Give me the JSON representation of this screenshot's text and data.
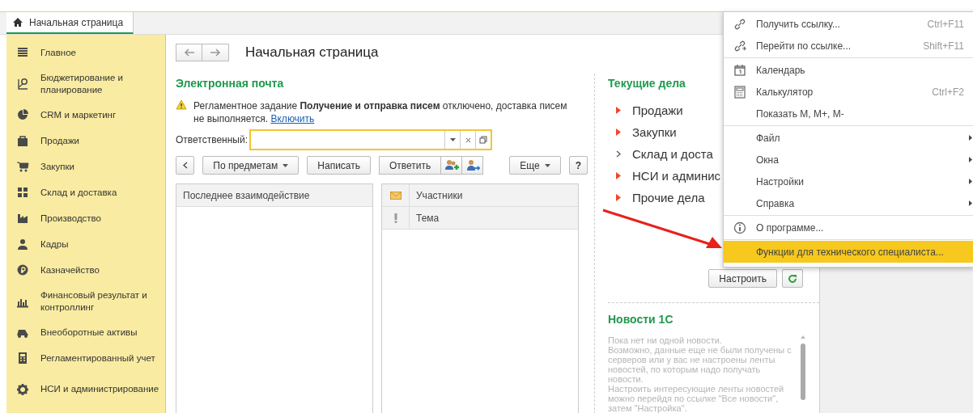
{
  "tab": {
    "label": "Начальная страница",
    "selected": true
  },
  "sidebar": {
    "items": [
      {
        "label": "Главное"
      },
      {
        "label": "Бюджетирование и планирование"
      },
      {
        "label": "CRM и маркетинг"
      },
      {
        "label": "Продажи"
      },
      {
        "label": "Закупки"
      },
      {
        "label": "Склад и доставка"
      },
      {
        "label": "Производство"
      },
      {
        "label": "Кадры"
      },
      {
        "label": "Казначейство"
      },
      {
        "label": "Финансовый результат и контроллинг"
      },
      {
        "label": "Внеоборотные активы"
      },
      {
        "label": "Регламентированный учет"
      },
      {
        "label": "НСИ и администрирование"
      }
    ]
  },
  "page_title": "Начальная страница",
  "email": {
    "title": "Электронная почта",
    "warning": "Регламентное задание **Получение и отправка писем** отключено, доставка писем не выполняется.",
    "warning_link": "Включить",
    "responsible_label": "Ответственный:",
    "toolbar": {
      "group_button": "По предметам",
      "write_button": "Написать",
      "reply_button": "Ответить",
      "more_button": "Еще",
      "help_button": "?"
    },
    "left_table": {
      "columns": [
        "Последнее взаимодействие"
      ]
    },
    "right_table": {
      "header_rows": [
        "Участники",
        "Тема"
      ]
    }
  },
  "tasks": {
    "title": "Текущие дела",
    "items": [
      {
        "label": "Продажи",
        "highlighted": true
      },
      {
        "label": "Закупки",
        "highlighted": true
      },
      {
        "label": "Склад и доста",
        "highlighted": false
      },
      {
        "label": "НСИ и админис",
        "highlighted": true
      },
      {
        "label": "Прочие дела",
        "highlighted": true
      }
    ],
    "configure_button": "Настроить"
  },
  "news": {
    "title": "Новости 1С",
    "paragraphs": [
      "Пока нет ни одной новости.",
      "Возможно, данные еще не были получены с серверов или у вас не настроены ленты новостей, по которым надо получать новости.",
      "Настроить интересующие ленты новостей можно перейдя по ссылке \"Все новости\", затем \"Настройка\"."
    ]
  },
  "menu": {
    "groups": [
      [
        {
          "label": "Получить ссылку...",
          "shortcut": "Ctrl+F11",
          "submenu": false,
          "selected": false
        },
        {
          "label": "Перейти по ссылке...",
          "shortcut": "Shift+F11",
          "submenu": false,
          "selected": false
        }
      ],
      [
        {
          "label": "Календарь",
          "submenu": false,
          "selected": false
        },
        {
          "label": "Калькулятор",
          "shortcut": "Ctrl+F2",
          "submenu": false,
          "selected": false
        },
        {
          "label": "Показать M, M+, M-",
          "submenu": false,
          "selected": false
        }
      ],
      [
        {
          "label": "Файл",
          "submenu": true,
          "selected": false
        },
        {
          "label": "Окна",
          "submenu": true,
          "selected": false
        },
        {
          "label": "Настройки",
          "submenu": true,
          "selected": false
        },
        {
          "label": "Справка",
          "submenu": true,
          "selected": false
        }
      ],
      [
        {
          "label": "О программе...",
          "submenu": false,
          "selected": false
        }
      ],
      [
        {
          "label": "Функции для технического специалиста...",
          "submenu": false,
          "selected": true
        }
      ]
    ]
  }
}
